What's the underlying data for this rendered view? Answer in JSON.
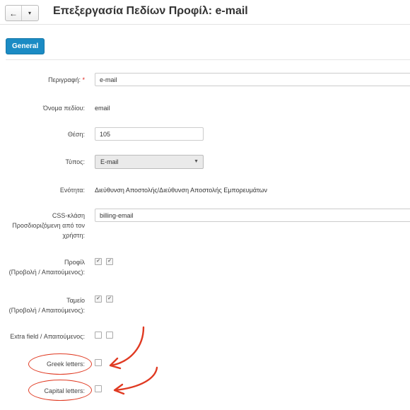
{
  "header": {
    "back_icon": "←",
    "dropdown_icon": "▾",
    "title": "Επεξεργασία Πεδίων Προφίλ: e-mail"
  },
  "tabs": {
    "general": "General"
  },
  "form": {
    "description": {
      "label": "Περιγραφή:",
      "required_mark": "*",
      "value": "e-mail"
    },
    "field_name": {
      "label": "Όνομα πεδίου:",
      "value": "email"
    },
    "position": {
      "label": "Θέση:",
      "value": "105"
    },
    "type": {
      "label": "Τύπος:",
      "value": "E-mail",
      "caret": "▼"
    },
    "section": {
      "label": "Ενότητα:",
      "value": "Διεύθυνση Αποστολής/Διεύθυνση Αποστολής Εμπορευμάτων"
    },
    "css_class": {
      "label": "CSS-κλάση Προσδιοριζόμενη από τον χρήστη:",
      "value": "billing-email"
    },
    "profile": {
      "label_1": "Προφίλ",
      "label_2": "(Προβολή / Απαιτούμενος):",
      "view": true,
      "required": true
    },
    "checkout": {
      "label_1": "Ταμείο",
      "label_2": "(Προβολή / Απαιτούμενος):",
      "view": true,
      "required": true
    },
    "extra_field": {
      "label": "Extra field / Απαιτούμενος:",
      "view": false,
      "required": false
    },
    "greek_letters": {
      "label": "Greek letters:",
      "checked": false
    },
    "capital_letters": {
      "label": "Capital letters:",
      "checked": false
    }
  },
  "check_glyph": "✔",
  "annotation_color": "#e03a22"
}
